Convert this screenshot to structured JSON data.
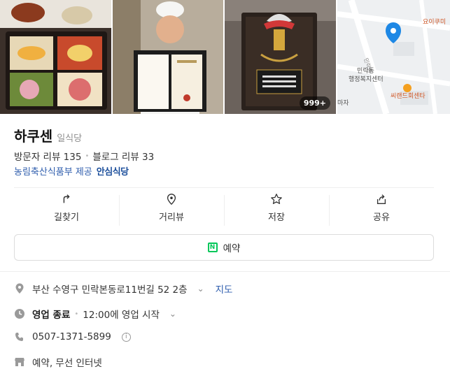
{
  "photos": {
    "count_badge": "999+",
    "map_labels": {
      "top_right": "요이쿠미",
      "road": "민락동",
      "center1": "민락동",
      "center2": "행정복지센터",
      "bottom": "씨랜드회센타",
      "edge": "마자"
    },
    "plaque_text": "안심식당"
  },
  "place": {
    "name": "하쿠센",
    "category": "일식당",
    "visitor_reviews": "방문자 리뷰 135",
    "blog_reviews": "블로그 리뷰 33",
    "provider": "농림축산식품부 제공",
    "provider_badge": "안심식당"
  },
  "actions": [
    {
      "label": "길찾기",
      "icon": "directions-icon"
    },
    {
      "label": "거리뷰",
      "icon": "street-view-icon"
    },
    {
      "label": "저장",
      "icon": "star-icon"
    },
    {
      "label": "공유",
      "icon": "share-icon"
    }
  ],
  "reserve": {
    "label": "예약"
  },
  "details": {
    "address": "부산 수영구 민락본동로11번길 52 2층",
    "map_link": "지도",
    "status": "영업 종료",
    "status_detail": "12:00에 영업 시작",
    "phone": "0507-1371-5899",
    "amenities": "예약, 무선 인터넷"
  },
  "colors": {
    "link_blue": "#2e5dad",
    "naver_green": "#03c75a",
    "map_pin": "#1e88e5"
  }
}
